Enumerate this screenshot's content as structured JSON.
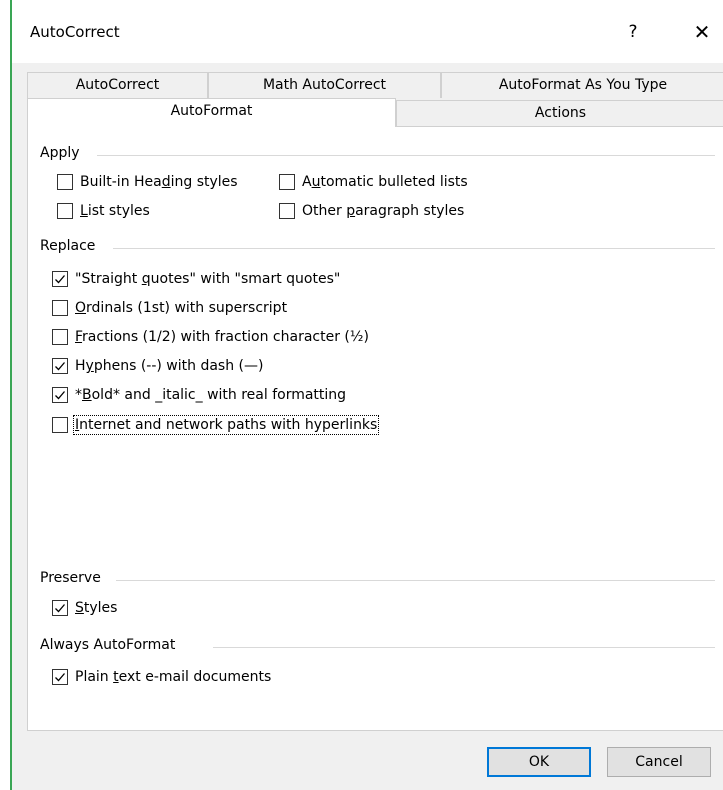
{
  "window": {
    "title": "AutoCorrect",
    "help_glyph": "?",
    "close_glyph": "✕",
    "border_color": "#3aa655"
  },
  "tabs": {
    "row1": [
      "AutoCorrect",
      "Math AutoCorrect",
      "AutoFormat As You Type"
    ],
    "row2": [
      "AutoFormat",
      "Actions"
    ],
    "active": "AutoFormat"
  },
  "sections": {
    "apply": {
      "label": "Apply",
      "items": [
        {
          "pre": "Built-in Hea",
          "acc": "d",
          "post": "ing styles",
          "checked": false
        },
        {
          "pre": "A",
          "acc": "u",
          "post": "tomatic bulleted lists",
          "checked": false
        },
        {
          "pre": "",
          "acc": "L",
          "post": "ist styles",
          "checked": false
        },
        {
          "pre": "Other ",
          "acc": "p",
          "post": "aragraph styles",
          "checked": false
        }
      ]
    },
    "replace": {
      "label": "Replace",
      "items": [
        {
          "pre": "\"Straight ",
          "acc": "q",
          "post": "uotes\" with \"smart quotes\"",
          "checked": true
        },
        {
          "pre": "",
          "acc": "O",
          "post": "rdinals (1st) with superscript",
          "checked": false
        },
        {
          "pre": "",
          "acc": "F",
          "post": "ractions (1/2) with fraction character (½)",
          "checked": false
        },
        {
          "pre": "H",
          "acc": "y",
          "post": "phens (--) with dash (—)",
          "checked": true
        },
        {
          "pre": "*",
          "acc": "B",
          "post": "old* and _italic_ with real formatting",
          "checked": true
        },
        {
          "pre": "",
          "acc": "I",
          "post": "nternet and network paths with hyperlinks",
          "checked": false
        }
      ]
    },
    "preserve": {
      "label": "Preserve",
      "items": [
        {
          "pre": "",
          "acc": "S",
          "post": "tyles",
          "checked": true
        }
      ]
    },
    "always": {
      "label": "Always AutoFormat",
      "items": [
        {
          "pre": "Plain ",
          "acc": "t",
          "post": "ext e-mail documents",
          "checked": true
        }
      ]
    }
  },
  "buttons": {
    "ok": "OK",
    "cancel": "Cancel"
  }
}
